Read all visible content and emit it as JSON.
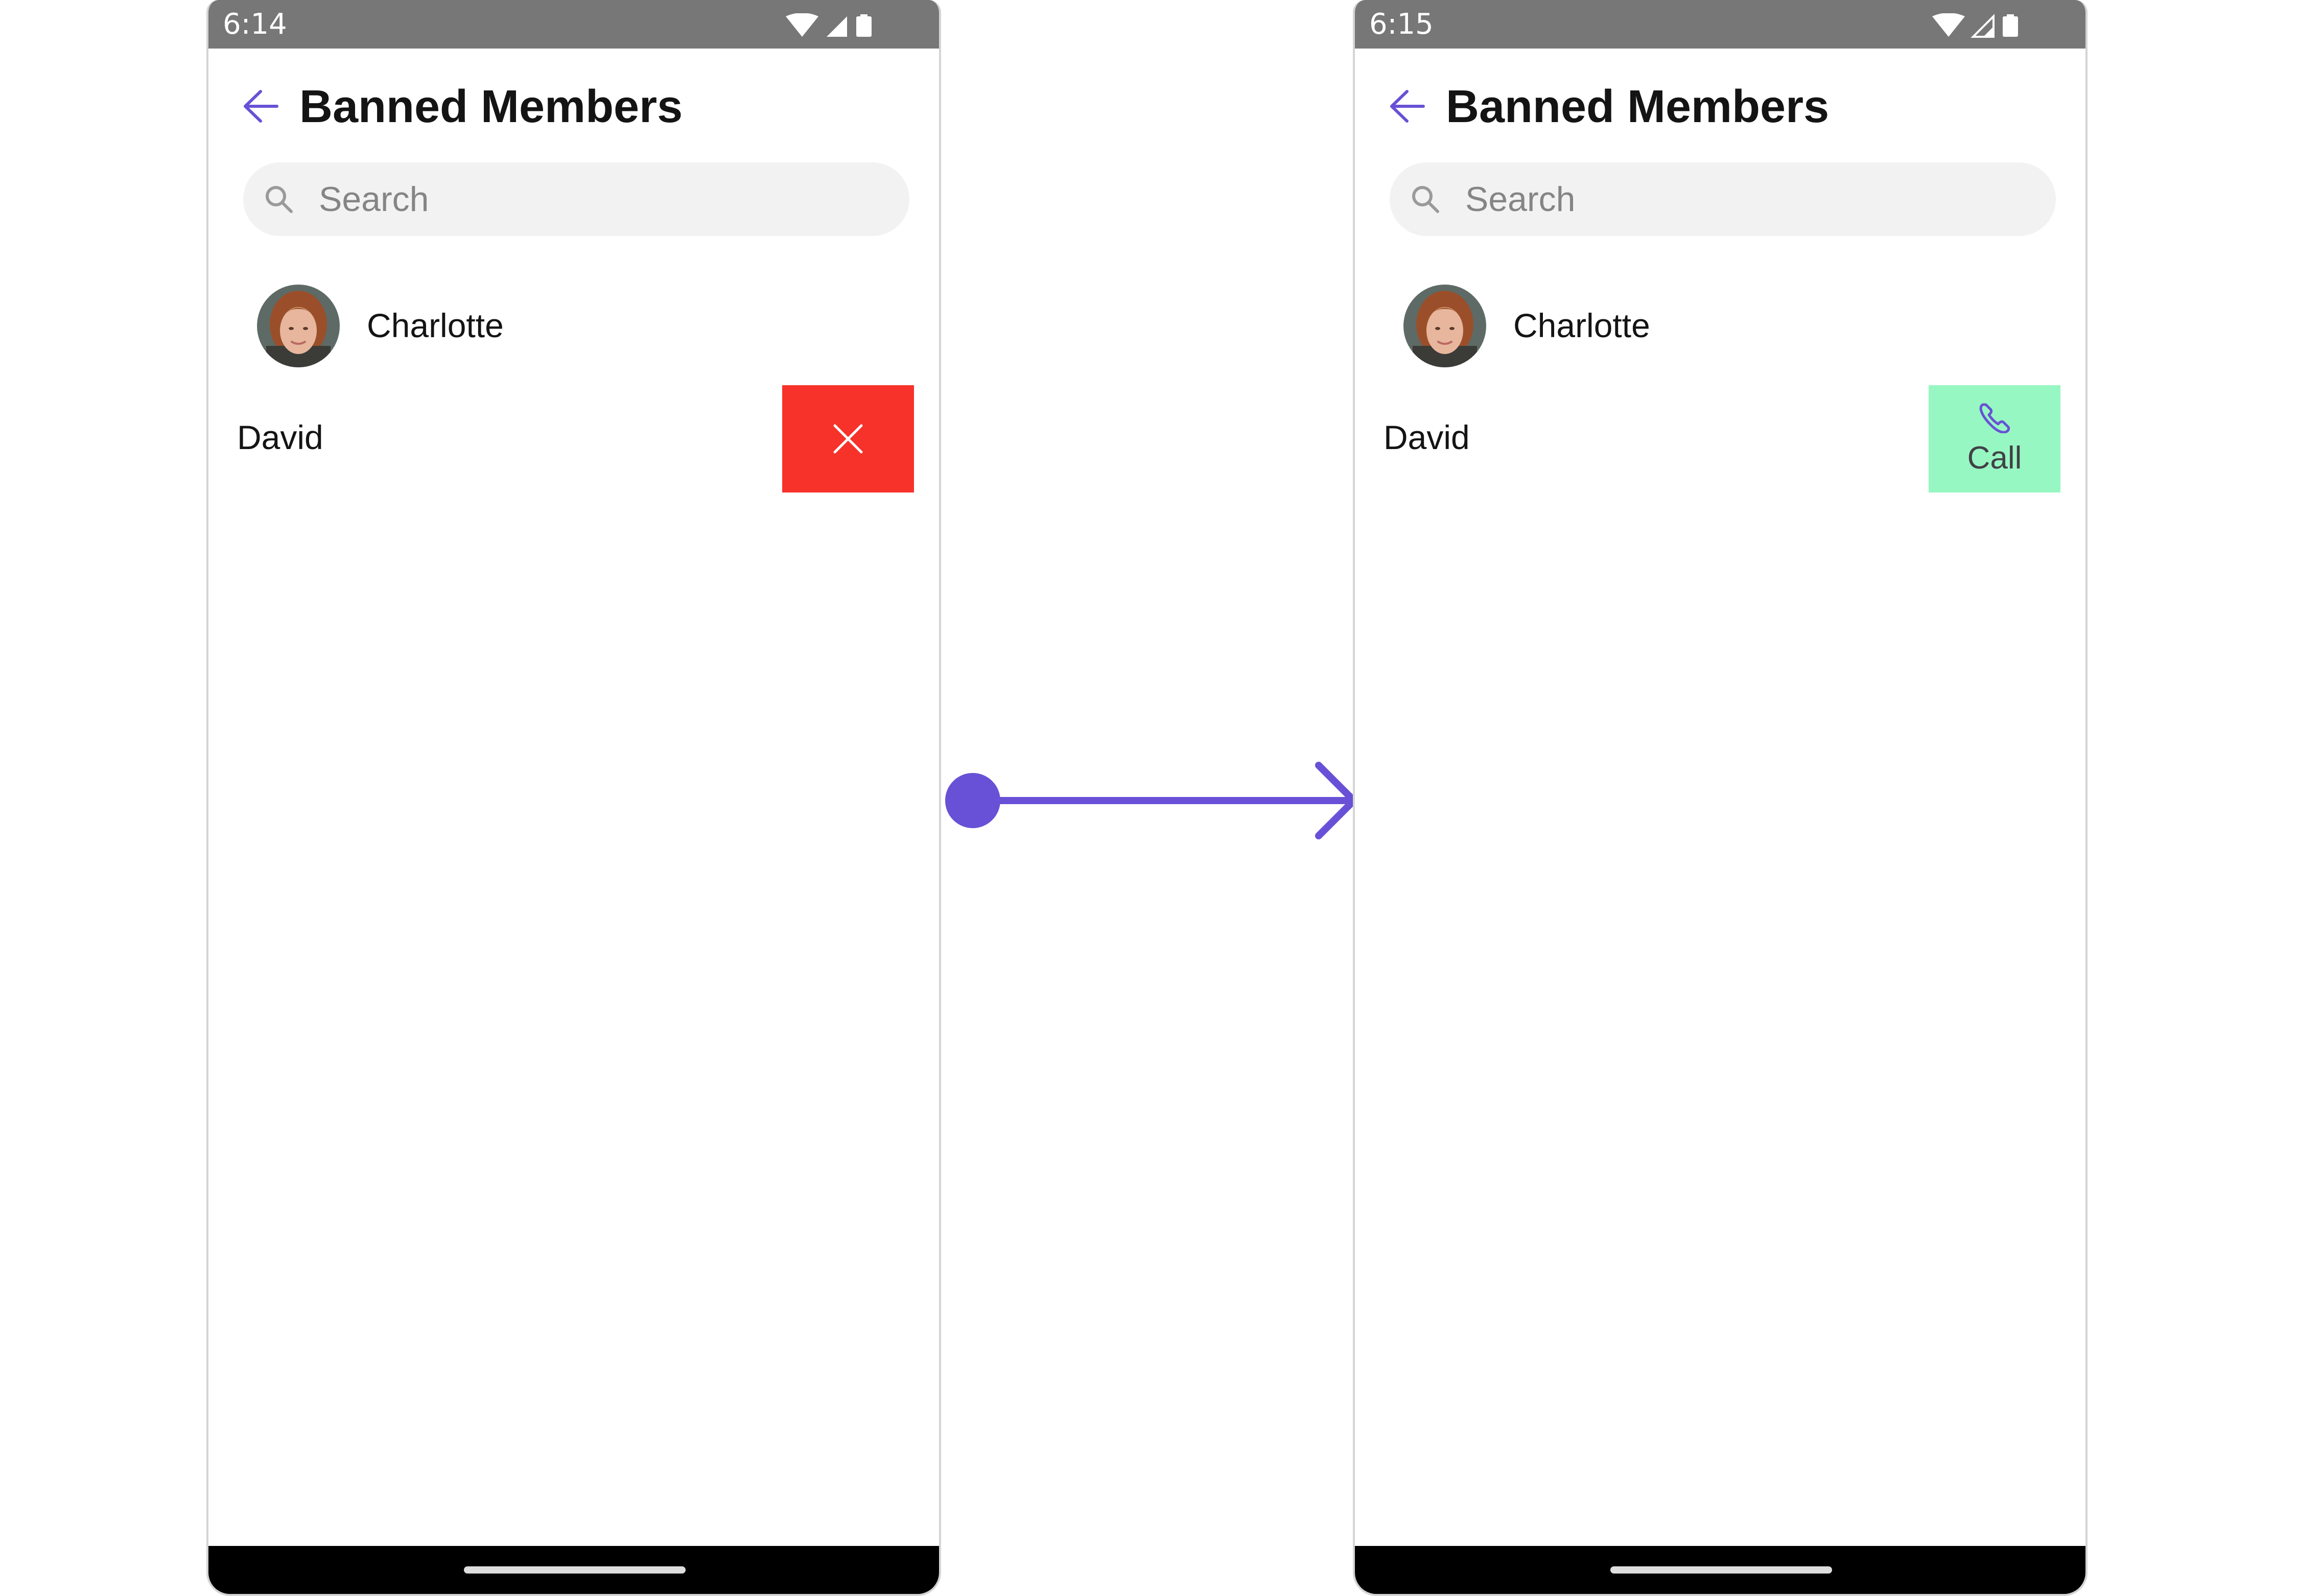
{
  "screens": [
    {
      "status_time": "6:14",
      "title": "Banned Members",
      "search_placeholder": "Search",
      "members": [
        {
          "name": "Charlotte",
          "has_avatar": true
        },
        {
          "name": "David",
          "swipe_action": {
            "type": "unban",
            "icon": "close-icon",
            "color": "#f6322b"
          }
        }
      ]
    },
    {
      "status_time": "6:15",
      "title": "Banned Members",
      "search_placeholder": "Search",
      "members": [
        {
          "name": "Charlotte",
          "has_avatar": true
        },
        {
          "name": "David",
          "swipe_action": {
            "type": "call",
            "icon": "phone-icon",
            "label": "Call",
            "color": "#97f7c2"
          }
        }
      ]
    }
  ],
  "colors": {
    "accent": "#6851d6",
    "status_bar": "#777777",
    "search_bg": "#f2f2f2",
    "nav_bar": "#000000"
  },
  "icons": {
    "back": "arrow-left-icon",
    "search": "search-icon",
    "wifi": "wifi-icon",
    "signal": "cellular-signal-icon",
    "battery": "battery-icon",
    "transition": "swipe-transition-arrow"
  }
}
